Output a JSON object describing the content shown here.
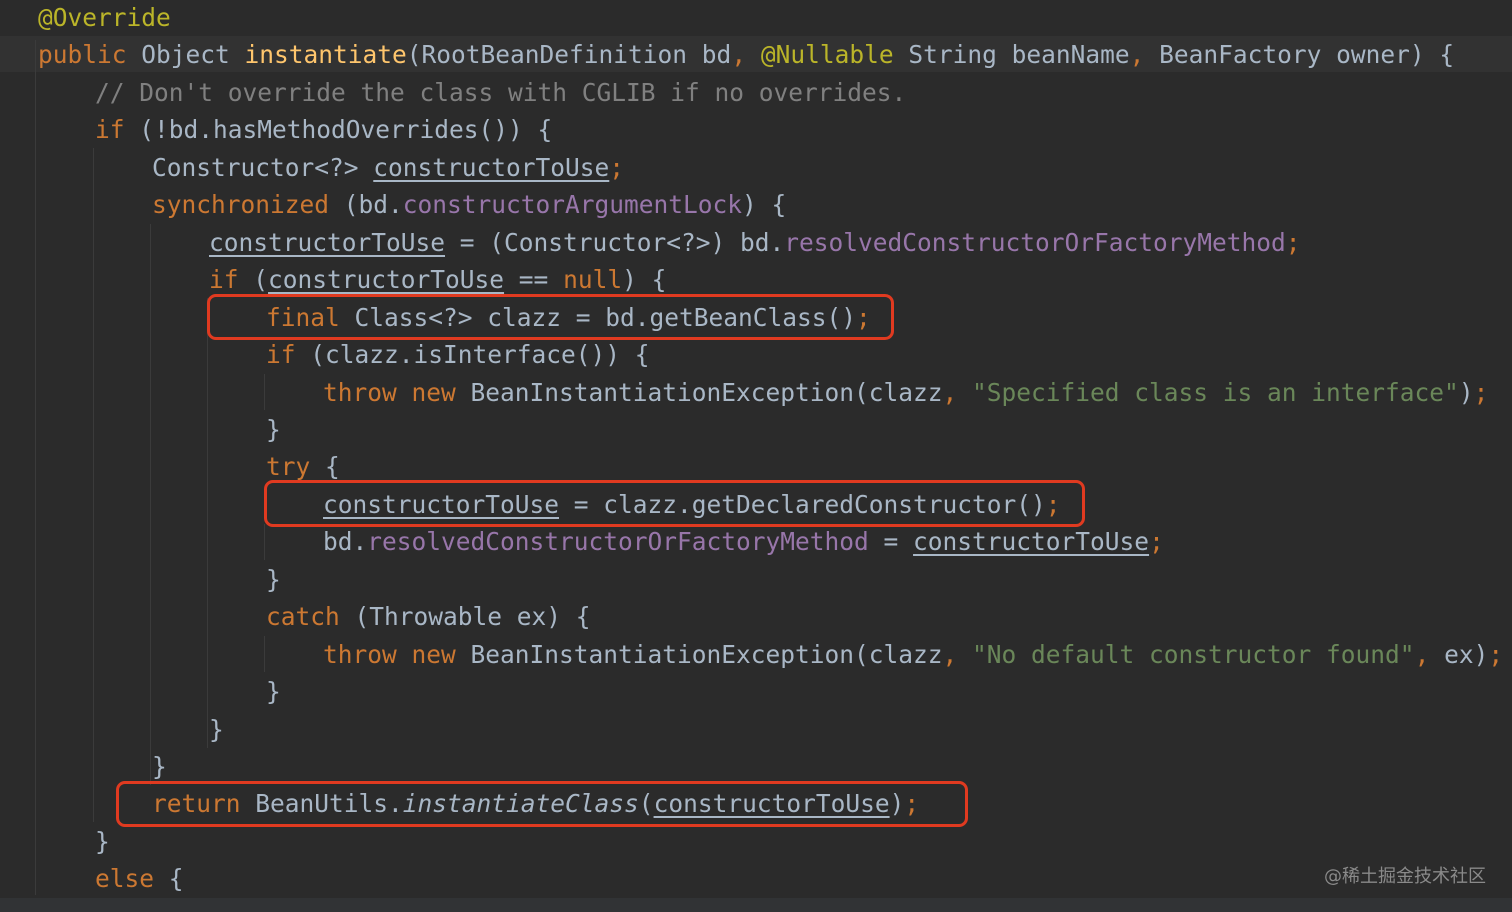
{
  "colors": {
    "background": "#2b2b2b",
    "keyword": "#cc7832",
    "annotation": "#bbb529",
    "method_declaration": "#ffc66d",
    "comment": "#808080",
    "string": "#6a8759",
    "field": "#9876aa",
    "text": "#a9b7c6",
    "highlight_box": "#e03a20"
  },
  "watermark": "@稀土掘金技术社区",
  "code": [
    [
      [
        "ann",
        "@Override"
      ]
    ],
    [
      [
        "kw",
        "public "
      ],
      [
        "txt",
        "Object "
      ],
      [
        "fn",
        "instantiate"
      ],
      [
        "txt",
        "(RootBeanDefinition bd"
      ],
      [
        "kw",
        ", "
      ],
      [
        "ann",
        "@Nullable "
      ],
      [
        "txt",
        "String beanName"
      ],
      [
        "kw",
        ", "
      ],
      [
        "txt",
        "BeanFactory owner) {"
      ]
    ],
    [
      [
        "cmt",
        "// Don't override the class with CGLIB if no overrides."
      ]
    ],
    [
      [
        "kw",
        "if "
      ],
      [
        "txt",
        "(!bd.hasMethodOverrides()) {"
      ]
    ],
    [
      [
        "txt",
        "Constructor<?> "
      ],
      [
        "txt-ul",
        "constructorToUse"
      ],
      [
        "kw",
        ";"
      ]
    ],
    [
      [
        "kw",
        "synchronized "
      ],
      [
        "txt",
        "(bd."
      ],
      [
        "fld",
        "constructorArgumentLock"
      ],
      [
        "txt",
        ") {"
      ]
    ],
    [
      [
        "txt-ul",
        "constructorToUse"
      ],
      [
        "txt",
        " = (Constructor<?>) bd."
      ],
      [
        "fld",
        "resolvedConstructorOrFactoryMethod"
      ],
      [
        "kw",
        ";"
      ]
    ],
    [
      [
        "kw",
        "if "
      ],
      [
        "txt",
        "("
      ],
      [
        "txt-ul",
        "constructorToUse"
      ],
      [
        "txt",
        " == "
      ],
      [
        "kw",
        "null"
      ],
      [
        "txt",
        ") {"
      ]
    ],
    [
      [
        "kw",
        "final "
      ],
      [
        "txt",
        "Class<?> clazz = bd.getBeanClass()"
      ],
      [
        "kw",
        ";"
      ]
    ],
    [
      [
        "kw",
        "if "
      ],
      [
        "txt",
        "(clazz.isInterface()) {"
      ]
    ],
    [
      [
        "kw",
        "throw new "
      ],
      [
        "txt",
        "BeanInstantiationException(clazz"
      ],
      [
        "kw",
        ", "
      ],
      [
        "str",
        "\"Specified class is an interface\""
      ],
      [
        "txt",
        ")"
      ],
      [
        "kw",
        ";"
      ]
    ],
    [
      [
        "txt",
        "}"
      ]
    ],
    [
      [
        "kw",
        "try "
      ],
      [
        "txt",
        "{"
      ]
    ],
    [
      [
        "txt-ul",
        "constructorToUse"
      ],
      [
        "txt",
        " = clazz.getDeclaredConstructor()"
      ],
      [
        "kw",
        ";"
      ]
    ],
    [
      [
        "txt",
        "bd."
      ],
      [
        "fld",
        "resolvedConstructorOrFactoryMethod"
      ],
      [
        "txt",
        " = "
      ],
      [
        "txt-ul",
        "constructorToUse"
      ],
      [
        "kw",
        ";"
      ]
    ],
    [
      [
        "txt",
        "}"
      ]
    ],
    [
      [
        "kw",
        "catch "
      ],
      [
        "txt",
        "(Throwable ex) {"
      ]
    ],
    [
      [
        "kw",
        "throw new "
      ],
      [
        "txt",
        "BeanInstantiationException(clazz"
      ],
      [
        "kw",
        ", "
      ],
      [
        "str",
        "\"No default constructor found\""
      ],
      [
        "kw",
        ", "
      ],
      [
        "txt",
        "ex)"
      ],
      [
        "kw",
        ";"
      ]
    ],
    [
      [
        "txt",
        "}"
      ]
    ],
    [
      [
        "txt",
        "}"
      ]
    ],
    [
      [
        "txt",
        "}"
      ]
    ],
    [
      [
        "kw",
        "return "
      ],
      [
        "txt",
        "BeanUtils."
      ],
      [
        "txt-it",
        "instantiateClass"
      ],
      [
        "txt",
        "("
      ],
      [
        "txt-ul",
        "constructorToUse"
      ],
      [
        "txt",
        ")"
      ],
      [
        "kw",
        ";"
      ]
    ],
    [
      [
        "txt",
        "}"
      ]
    ],
    [
      [
        "kw",
        "else "
      ],
      [
        "txt",
        "{"
      ]
    ]
  ]
}
